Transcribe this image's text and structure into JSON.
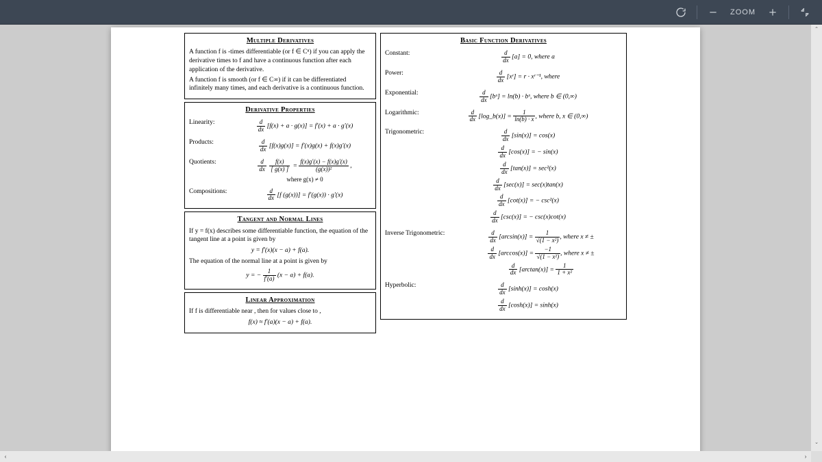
{
  "toolbar": {
    "rotate_tooltip": "Rotate",
    "zoom_out_tooltip": "Zoom out",
    "zoom_label": "ZOOM",
    "zoom_in_tooltip": "Zoom in",
    "fullscreen_tooltip": "Fit to window"
  },
  "left": {
    "multiple": {
      "title": "Multiple Derivatives",
      "p1": "A function f is -times differentiable (or f ∈ Cⁿ) if you can apply the derivative   times to f and have a continuous function after each application of the derivative.",
      "p2": "A function f is smooth (or f ∈ C∞) if it can be differentiated infinitely many times, and each derivative is a continuous function."
    },
    "props": {
      "title": "Derivative Properties",
      "linearity_label": "Linearity:",
      "linearity_eq": "[f(x) + a · g(x)] = f′(x) + a · g′(x)",
      "products_label": "Products:",
      "products_eq": "[f(x)g(x)] = f′(x)g(x) + f(x)g′(x)",
      "quotients_label": "Quotients:",
      "quotients_num": "f(x)g′(x) − f(x)g′(x)",
      "quotients_den": "(g(x))²",
      "quotients_note": "where g(x) ≠ 0",
      "comp_label": "Compositions:",
      "comp_eq": "[f (g(x))] = f′(g(x)) · g′(x)"
    },
    "tangent": {
      "title": "Tangent and Normal Lines",
      "p1a": "If y = f(x) describes some differentiable function, the equation of the tangent line at a point ",
      "p1b": " is given by",
      "eq1": "y  = f′(x)(x − a) + f(a).",
      "p2a": "The equation of the normal line at a point ",
      "p2b": " is given by",
      "eq2_pre": "y  = −",
      "eq2_num": "1",
      "eq2_den": "f′(a)",
      "eq2_post": " (x − a) + f(a)."
    },
    "linear": {
      "title": "Linear Approximation",
      "p1": "If f is differentiable near   , then for values close to  ,",
      "eq": "f(x) ≈ f′(a)(x − a) + f(a)."
    }
  },
  "right": {
    "title": "Basic Function Derivatives",
    "constant_label": "Constant:",
    "constant_eq": "[a] = 0, where a",
    "power_label": "Power:",
    "power_eq": "[xʳ] = r · xʳ⁻¹, where",
    "exp_label": "Exponential:",
    "exp_eq": "[bˣ] = ln(b) · bˣ, where b ∈ (0,∞)",
    "log_label": "Logarithmic:",
    "log_pre": "[log_b(x)] = ",
    "log_num": "1",
    "log_den": "ln(b) · x",
    "log_post": ", where b, x ∈ (0,∞)",
    "trig_label": "Trigonometric:",
    "trig": [
      "[sin(x)] = cos(x)",
      "[cos(x)] = − sin(x)",
      "[tan(x)] = sec²(x)",
      "[sec(x)] = sec(x)tan(x)",
      "[cot(x)] = − csc²(x)",
      "[csc(x)] = − csc(x)cot(x)"
    ],
    "invtrig_label": "Inverse Trigonometric:",
    "arcsin_pre": "[arcsin(x)] = ",
    "arcsin_num": "1",
    "arcsin_den": "√(1 − x²)",
    "arcsin_post": ", where x ≠ ±",
    "arccos_pre": "[arccos(x)] = ",
    "arccos_num": "−1",
    "arccos_den": "√(1 − x²)",
    "arccos_post": ", where x ≠ ±",
    "arctan_pre": "[arctan(x)] = ",
    "arctan_num": "1",
    "arctan_den": "1 + x²",
    "hyp_label": "Hyperbolic:",
    "hyp": [
      "[sinh(x)] = cosh(x)",
      "[cosh(x)] = sinh(x)"
    ]
  }
}
